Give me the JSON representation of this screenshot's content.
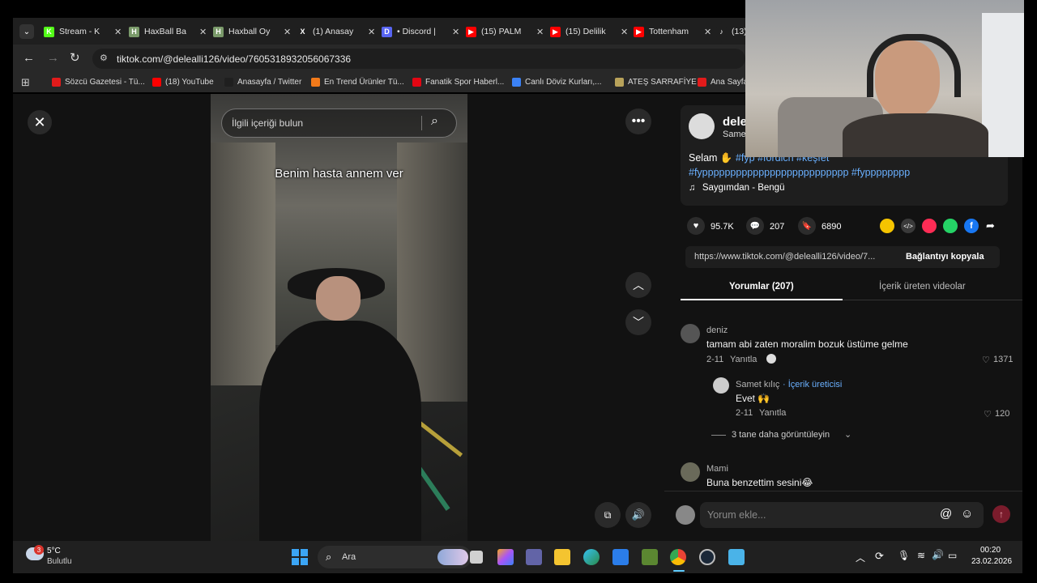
{
  "tabs": [
    {
      "label": "Stream - K",
      "fav_color": "#53fc18",
      "fav_glyph": "K"
    },
    {
      "label": "HaxBall Ba",
      "fav_color": "#7a9a6a",
      "fav_glyph": "H"
    },
    {
      "label": "Haxball Oy",
      "fav_color": "#7a9a6a",
      "fav_glyph": "H"
    },
    {
      "label": "(1) Anasay",
      "fav_color": "#1f1f1f",
      "fav_glyph": "X"
    },
    {
      "label": "• Discord |",
      "fav_color": "#5865f2",
      "fav_glyph": "D"
    },
    {
      "label": "(15) PALM",
      "fav_color": "#ff0000",
      "fav_glyph": "▶"
    },
    {
      "label": "(15) Delilik",
      "fav_color": "#ff0000",
      "fav_glyph": "▶"
    },
    {
      "label": "Tottenham",
      "fav_color": "#ff0000",
      "fav_glyph": "▶"
    },
    {
      "label": "(13)",
      "fav_color": "#1f1f1f",
      "fav_glyph": "♪"
    }
  ],
  "address": {
    "url": "tiktok.com/@delealli126/video/7605318932056067336"
  },
  "bookmarks": [
    {
      "label": "Sözcü Gazetesi - Tü...",
      "color": "#e21b1b"
    },
    {
      "label": "(18) YouTube",
      "color": "#ff0000"
    },
    {
      "label": "Anasayfa / Twitter",
      "color": "#1f1f1f"
    },
    {
      "label": "En Trend Ürünler Tü...",
      "color": "#f27a1a"
    },
    {
      "label": "Fanatik Spor Haberl...",
      "color": "#e30613"
    },
    {
      "label": "Canlı Döviz Kurları,...",
      "color": "#3b82f6"
    },
    {
      "label": "ATEŞ SARRAFİYE",
      "color": "#b8a25a"
    },
    {
      "label": "Ana Sayfa",
      "color": "#e21b1b"
    }
  ],
  "player": {
    "search_placeholder": "İlgili içeriği bulun",
    "caption": "Benim hasta annem ver"
  },
  "author": {
    "name_partial": "dele",
    "sub_partial": "Same"
  },
  "description": {
    "text": "Selam",
    "hashtags": "#fyp #fordich #keşfet",
    "hashtags_line2a": "#fypppppppppppppppppppppppppp",
    "hashtags_line2b": "#fypppppppp",
    "music": "Saygımdan - Bengü"
  },
  "stats": {
    "likes": "95.7K",
    "comments": "207",
    "saves": "6890"
  },
  "share": {
    "link": "https://www.tiktok.com/@delealli126/video/7...",
    "copy_label": "Bağlantıyı kopyala"
  },
  "panel_tabs": {
    "comments": "Yorumlar (207)",
    "creator_videos": "İçerik üreten videolar"
  },
  "comments": [
    {
      "user": "deniz",
      "text": "tamam abi zaten moralim bozuk üstüme gelme",
      "date": "2-11",
      "reply": "Yanıtla",
      "likes": "1371"
    },
    {
      "user": "Mami",
      "text": "Buna benzettim sesini😂",
      "date": "",
      "reply": "",
      "likes": ""
    }
  ],
  "reply": {
    "user": "Samet kılıç",
    "badge": "· İçerik üreticisi",
    "text": "Evet 🙌",
    "date": "2-11",
    "reply": "Yanıtla",
    "likes": "120"
  },
  "more_replies": "3 tane daha görüntüleyin",
  "comment_input": {
    "placeholder": "Yorum ekle..."
  },
  "taskbar": {
    "weather_temp": "5°C",
    "weather_desc": "Bulutlu",
    "weather_badge": "3",
    "search_label": "Ara",
    "time": "00:20",
    "date": "23.02.2026"
  },
  "colors": {
    "accent_pink": "#fe2c55",
    "link_blue": "#6ab0ff",
    "page_bg": "#121212"
  }
}
